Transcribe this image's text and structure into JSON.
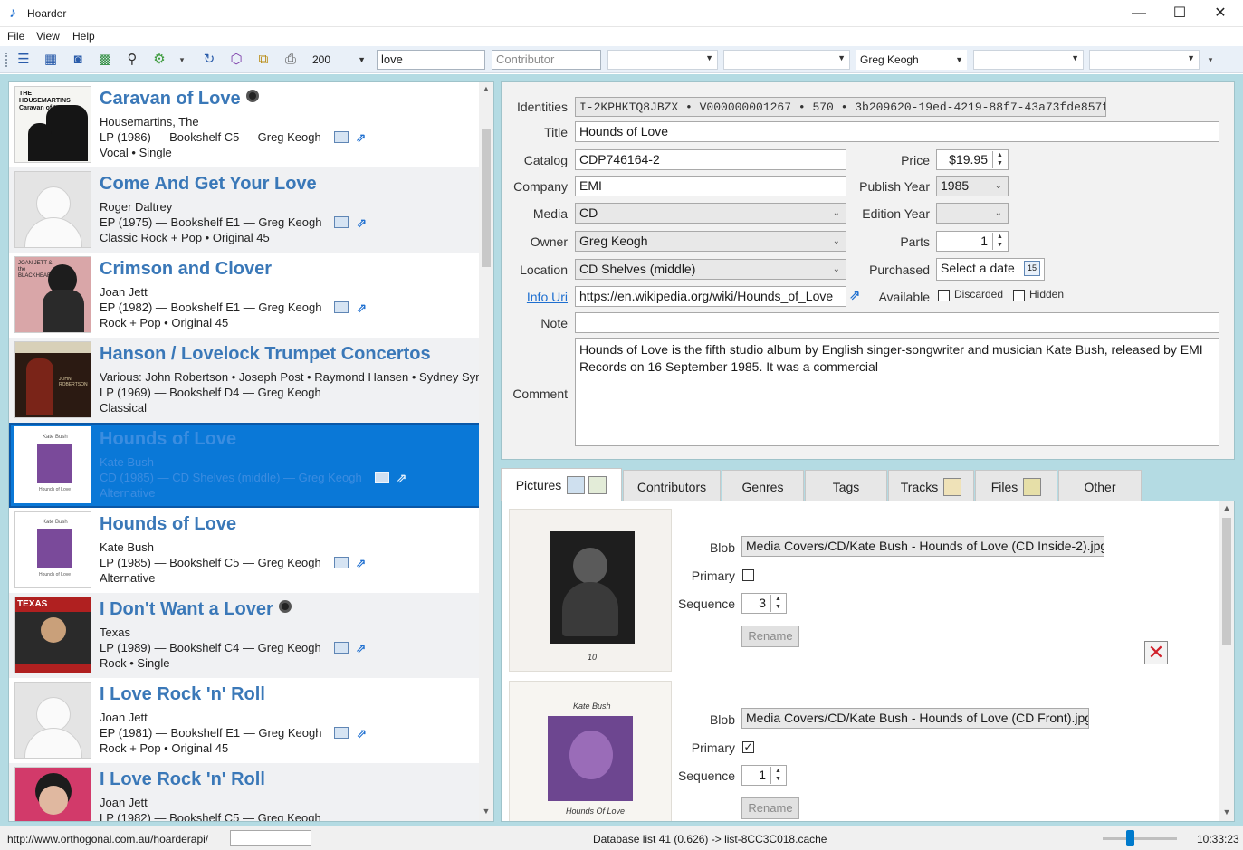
{
  "window": {
    "title": "Hoarder"
  },
  "menu": [
    "File",
    "View",
    "Help"
  ],
  "toolbar": {
    "page_size": "200",
    "search_value": "love",
    "contributor_placeholder": "Contributor",
    "owner_filter": "Greg Keogh"
  },
  "list": [
    {
      "title": "Caravan of Love",
      "artist": "Housemartins, The",
      "info": "LP (1986) — Bookshelf C5 — Greg Keogh",
      "genres": "Vocal • Single",
      "has_disc": true,
      "thumb": "cover"
    },
    {
      "title": "Come And Get Your Love",
      "artist": "Roger Daltrey",
      "info": "EP (1975) — Bookshelf E1 — Greg Keogh",
      "genres": "Classic Rock + Pop • Original 45",
      "has_disc": false,
      "thumb": "placeholder"
    },
    {
      "title": "Crimson and Clover",
      "artist": "Joan Jett",
      "info": "EP (1982) — Bookshelf E1 — Greg Keogh",
      "genres": "Rock + Pop • Original 45",
      "has_disc": false,
      "thumb": "cover"
    },
    {
      "title": "Hanson / Lovelock Trumpet Concertos",
      "artist": "Various: John Robertson • Joseph Post • Raymond Hansen • Sydney Symp",
      "info": "LP (1969) — Bookshelf D4 — Greg Keogh",
      "genres": "Classical",
      "has_disc": false,
      "thumb": "cover"
    },
    {
      "title": "Hounds of Love",
      "artist": "Kate Bush",
      "info": "CD (1985) — CD Shelves (middle) — Greg Keogh",
      "genres": "Alternative",
      "has_disc": false,
      "thumb": "cover"
    },
    {
      "title": "Hounds of Love",
      "artist": "Kate Bush",
      "info": "LP (1985) — Bookshelf C5 — Greg Keogh",
      "genres": "Alternative",
      "has_disc": false,
      "thumb": "cover"
    },
    {
      "title": "I Don't Want a Lover",
      "artist": "Texas",
      "info": "LP (1989) — Bookshelf C4 — Greg Keogh",
      "genres": "Rock • Single",
      "has_disc": true,
      "thumb": "cover"
    },
    {
      "title": "I Love Rock 'n' Roll",
      "artist": "Joan Jett",
      "info": "EP (1981) — Bookshelf E1 — Greg Keogh",
      "genres": "Rock + Pop • Original 45",
      "has_disc": false,
      "thumb": "placeholder"
    },
    {
      "title": "I Love Rock 'n' Roll",
      "artist": "Joan Jett",
      "info": "LP (1982) — Bookshelf C5 — Greg Keogh",
      "genres": "",
      "has_disc": false,
      "thumb": "cover"
    }
  ],
  "thumb_text": {
    "caravan": "THE HOUSEMARTINS Caravan of Love",
    "crimson": "JOAN JETT & the BLACKHEARTS",
    "texas": "TEXAS",
    "hanson": "JOHN ROBERTSON",
    "kate": "Kate Bush",
    "kate_sub": "Hounds of Love"
  },
  "detail": {
    "labels": {
      "identities": "Identities",
      "title": "Title",
      "catalog": "Catalog",
      "company": "Company",
      "media": "Media",
      "owner": "Owner",
      "location": "Location",
      "info_uri": "Info Uri",
      "note": "Note",
      "comment": "Comment",
      "price": "Price",
      "publish_year": "Publish Year",
      "edition_year": "Edition Year",
      "parts": "Parts",
      "purchased": "Purchased",
      "available": "Available",
      "discarded": "Discarded",
      "hidden": "Hidden"
    },
    "identities": "I-2KPHKTQ8JBZX • V000000001267 • 570 • 3b209620-19ed-4219-88f7-43a73fde857f",
    "title": "Hounds of Love",
    "catalog": "CDP746164-2",
    "company": "EMI",
    "media": "CD",
    "owner": "Greg Keogh",
    "location": "CD Shelves (middle)",
    "info_uri": "https://en.wikipedia.org/wiki/Hounds_of_Love",
    "note": "",
    "comment": "Hounds of Love is the fifth studio album by English singer-songwriter and musician Kate Bush, released by EMI Records on 16 September 1985. It was a commercial",
    "price": "$19.95",
    "publish_year": "1985",
    "edition_year": "",
    "parts": "1",
    "purchased_placeholder": "Select a date",
    "calendar_day": "15",
    "discarded": false,
    "hidden": false
  },
  "tabs": [
    "Pictures",
    "Contributors",
    "Genres",
    "Tags",
    "Tracks",
    "Files",
    "Other"
  ],
  "pictures": {
    "labels": {
      "blob": "Blob",
      "primary": "Primary",
      "sequence": "Sequence",
      "rename": "Rename"
    },
    "items": [
      {
        "blob": "Media Covers/CD/Kate Bush - Hounds of Love (CD Inside-2).jpg",
        "primary": false,
        "sequence": "3",
        "caption": "10"
      },
      {
        "blob": "Media Covers/CD/Kate Bush - Hounds of Love (CD Front).jpg",
        "primary": true,
        "sequence": "1",
        "caption": "Hounds Of Love",
        "header": "Kate Bush"
      }
    ]
  },
  "status": {
    "url": "http://www.orthogonal.com.au/hoarderapi/",
    "database": "Database list 41 (0.626) -> list-8CC3C018.cache",
    "time": "10:33:23"
  },
  "colors": {
    "accent": "#3a78b8",
    "selection": "#0a78d7",
    "background": "#b4dbe3"
  }
}
